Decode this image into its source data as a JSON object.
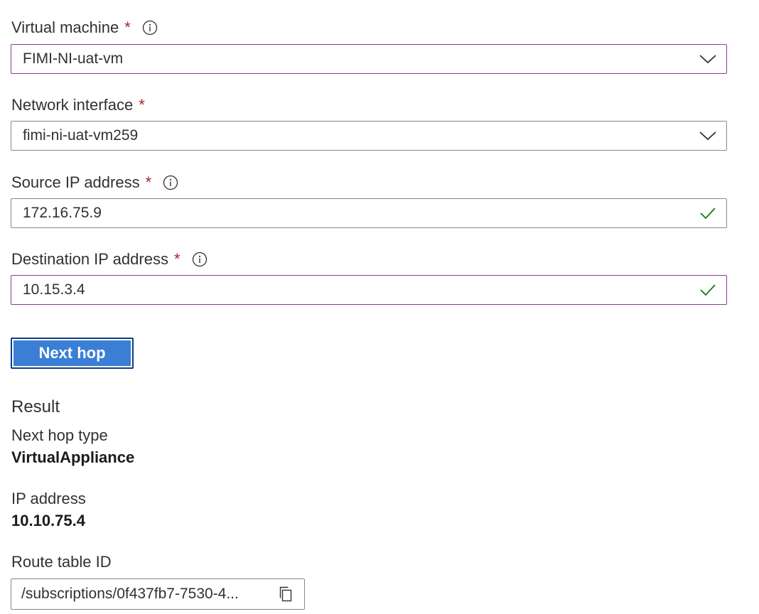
{
  "form": {
    "virtual_machine": {
      "label": "Virtual machine",
      "required_mark": "*",
      "value": "FIMI-NI-uat-vm",
      "icon": "chevron-down-icon"
    },
    "network_interface": {
      "label": "Network interface",
      "required_mark": "*",
      "value": "fimi-ni-uat-vm259",
      "icon": "chevron-down-icon"
    },
    "source_ip": {
      "label": "Source IP address",
      "required_mark": "*",
      "value": "172.16.75.9",
      "icon": "checkmark-icon"
    },
    "destination_ip": {
      "label": "Destination IP address",
      "required_mark": "*",
      "value": "10.15.3.4",
      "icon": "checkmark-icon"
    },
    "next_hop_button": "Next hop"
  },
  "result": {
    "heading": "Result",
    "next_hop_type_label": "Next hop type",
    "next_hop_type_value": "VirtualAppliance",
    "ip_address_label": "IP address",
    "ip_address_value": "10.10.75.4",
    "route_table_label": "Route table ID",
    "route_table_value": "/subscriptions/0f437fb7-7530-4...",
    "copy_icon": "copy-icon"
  },
  "colors": {
    "required": "#a4262c",
    "focus_border": "#8a3a94",
    "check": "#107c10",
    "button": "#3a7ed6"
  }
}
